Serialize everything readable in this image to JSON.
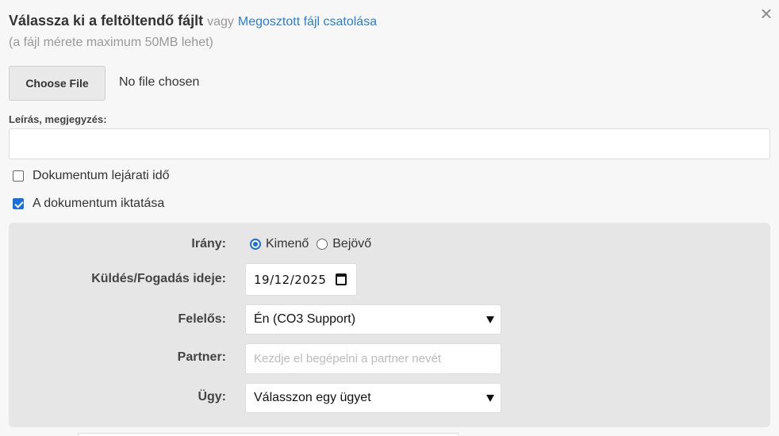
{
  "header": {
    "title_main": "Válassza ki a feltöltendő fájlt",
    "title_or": "vagy",
    "title_link": "Megosztott fájl csatolása",
    "size_note": "(a fájl mérete maximum 50MB lehet)",
    "close_label": "×"
  },
  "file": {
    "button_label": "Choose File",
    "status": "No file chosen"
  },
  "description": {
    "label": "Leírás, megjegyzés:",
    "value": ""
  },
  "checkboxes": [
    {
      "label": "Dokumentum lejárati idő",
      "checked": false
    },
    {
      "label": "A dokumentum iktatása",
      "checked": true
    }
  ],
  "registration": {
    "direction_label": "Irány:",
    "direction_options": [
      {
        "label": "Kimenő",
        "selected": true
      },
      {
        "label": "Bejövő",
        "selected": false
      }
    ],
    "date_label": "Küldés/Fogadás ideje:",
    "date_value": "19/12/2025",
    "responsible_label": "Felelős:",
    "responsible_value": "Én (CO3 Support)",
    "partner_label": "Partner:",
    "partner_placeholder": "Kezdje el begépelni a partner nevét",
    "case_label": "Ügy:",
    "case_value": "Válasszon egy ügyet"
  },
  "colors": {
    "link": "#2a7fd4",
    "accent": "#1a6fd8",
    "panel": "#e6e6e6"
  }
}
